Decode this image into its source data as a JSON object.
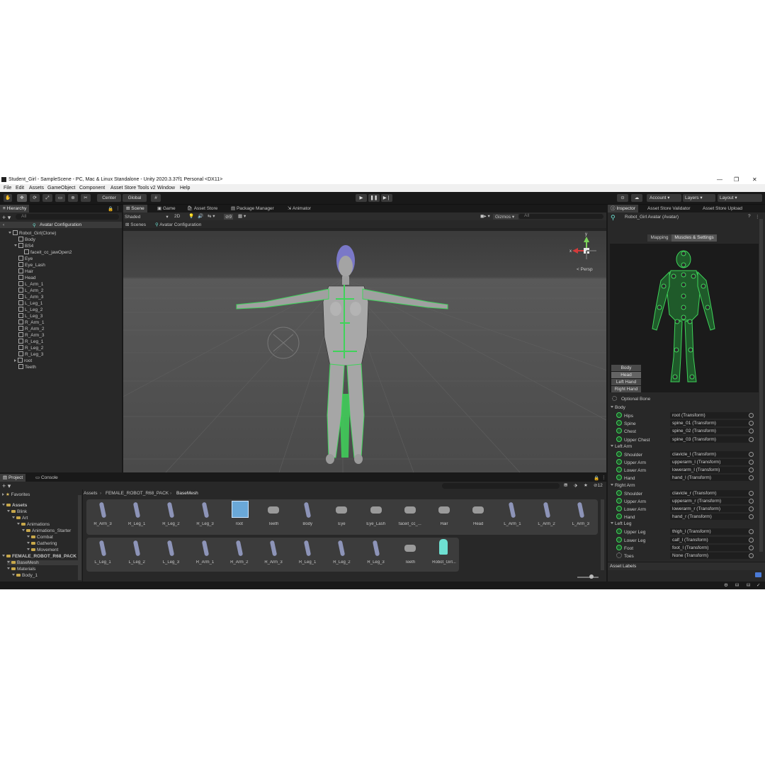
{
  "window": {
    "title": "Student_Girl - SampleScene - PC, Mac & Linux Standalone - Unity 2020.3.37f1 Personal <DX11>",
    "minimize": "—",
    "maximize": "❐",
    "close": "✕"
  },
  "menu": [
    "File",
    "Edit",
    "Assets",
    "GameObject",
    "Component",
    "Asset Store Tools v2",
    "Window",
    "Help"
  ],
  "toolbar": {
    "pivot": "Center",
    "space": "Global",
    "account": "Account",
    "layers": "Layers",
    "layout": "Layout"
  },
  "hierarchy": {
    "tab": "Hierarchy",
    "search_placeholder": "All",
    "root": "Avatar Configuration",
    "items": [
      {
        "label": "Robot_Girl(Clone)",
        "indent": 1,
        "arrow": "down"
      },
      {
        "label": "Body",
        "indent": 2
      },
      {
        "label": "BS4",
        "indent": 2,
        "arrow": "down"
      },
      {
        "label": "faceit_cc_jawOpen2",
        "indent": 3
      },
      {
        "label": "Eye",
        "indent": 2
      },
      {
        "label": "Eye_Lash",
        "indent": 2
      },
      {
        "label": "Hair",
        "indent": 2
      },
      {
        "label": "Head",
        "indent": 2
      },
      {
        "label": "L_Arm_1",
        "indent": 2
      },
      {
        "label": "L_Arm_2",
        "indent": 2
      },
      {
        "label": "L_Arm_3",
        "indent": 2
      },
      {
        "label": "L_Leg_1",
        "indent": 2
      },
      {
        "label": "L_Leg_2",
        "indent": 2
      },
      {
        "label": "L_Leg_3",
        "indent": 2
      },
      {
        "label": "R_Arm_1",
        "indent": 2
      },
      {
        "label": "R_Arm_2",
        "indent": 2
      },
      {
        "label": "R_Arm_3",
        "indent": 2
      },
      {
        "label": "R_Leg_1",
        "indent": 2
      },
      {
        "label": "R_Leg_2",
        "indent": 2
      },
      {
        "label": "R_Leg_3",
        "indent": 2
      },
      {
        "label": "root",
        "indent": 2,
        "arrow": "right"
      },
      {
        "label": "Teeth",
        "indent": 2
      }
    ]
  },
  "scene": {
    "tabs": [
      "Scene",
      "Game",
      "Asset Store",
      "Package Manager",
      "Animator"
    ],
    "shading": "Shaded",
    "mode_2d": "2D",
    "gizmos": "Gizmos",
    "search_placeholder": "All",
    "hidden_count": "9",
    "breadcrumb_scenes": "Scenes",
    "breadcrumb_current": "Avatar Configuration",
    "persp": "Persp",
    "axis_y": "y",
    "axis_x": "x"
  },
  "inspector": {
    "tabs": [
      "Inspector",
      "Asset Store Validator",
      "Asset Store Upload"
    ],
    "object_name": "Robot_Girl Avatar (Avatar)",
    "mode_tabs": [
      "Mapping",
      "Muscles & Settings"
    ],
    "body_parts": [
      "Body",
      "Head",
      "Left Hand",
      "Right Hand"
    ],
    "optional_bone": "Optional Bone",
    "sections": [
      {
        "name": "Body",
        "bones": [
          {
            "label": "Hips",
            "value": "root (Transform)"
          },
          {
            "label": "Spine",
            "value": "spine_01 (Transform)"
          },
          {
            "label": "Chest",
            "value": "spine_02 (Transform)"
          },
          {
            "label": "Upper Chest",
            "value": "spine_03 (Transform)"
          }
        ]
      },
      {
        "name": "Left Arm",
        "bones": [
          {
            "label": "Shoulder",
            "value": "clavicle_l (Transform)"
          },
          {
            "label": "Upper Arm",
            "value": "upperarm_l (Transform)"
          },
          {
            "label": "Lower Arm",
            "value": "lowerarm_l (Transform)"
          },
          {
            "label": "Hand",
            "value": "hand_l (Transform)"
          }
        ]
      },
      {
        "name": "Right Arm",
        "bones": [
          {
            "label": "Shoulder",
            "value": "clavicle_r (Transform)"
          },
          {
            "label": "Upper Arm",
            "value": "upperarm_r (Transform)"
          },
          {
            "label": "Lower Arm",
            "value": "lowerarm_r (Transform)"
          },
          {
            "label": "Hand",
            "value": "hand_r (Transform)"
          }
        ]
      },
      {
        "name": "Left Leg",
        "bones": [
          {
            "label": "Upper Leg",
            "value": "thigh_l (Transform)"
          },
          {
            "label": "Lower Leg",
            "value": "calf_l (Transform)"
          },
          {
            "label": "Foot",
            "value": "foot_l (Transform)"
          },
          {
            "label": "Toes",
            "value": "None (Transform)"
          }
        ]
      }
    ],
    "asset_labels": "Asset Labels"
  },
  "project": {
    "tabs": [
      "Project",
      "Console"
    ],
    "favorites": "Favorites",
    "tree": [
      {
        "label": "Assets",
        "indent": 0
      },
      {
        "label": "Blink",
        "indent": 1
      },
      {
        "label": "Art",
        "indent": 2
      },
      {
        "label": "Animations",
        "indent": 3
      },
      {
        "label": "Animations_Starter",
        "indent": 4
      },
      {
        "label": "Combat",
        "indent": 5
      },
      {
        "label": "Gathering",
        "indent": 5
      },
      {
        "label": "Movement",
        "indent": 5
      },
      {
        "label": "FEMALE_ROBOT_R68_PACK",
        "indent": 0
      },
      {
        "label": "BaseMesh",
        "indent": 1
      },
      {
        "label": "Materials",
        "indent": 1
      },
      {
        "label": "Body_1",
        "indent": 2
      }
    ],
    "breadcrumb": [
      "Assets",
      "FEMALE_ROBOT_R68_PACK",
      "BaseMesh"
    ],
    "hidden_count": "12",
    "row1": [
      "R_Arm_3",
      "R_Leg_1",
      "R_Leg_2",
      "R_Leg_3",
      "root",
      "Teeth",
      "Body",
      "Eye",
      "Eye_Lash",
      "faceit_cc_...",
      "Hair",
      "Head",
      "L_Arm_1",
      "L_Arm_2",
      "L_Arm_3"
    ],
    "row2": [
      "L_Leg_1",
      "L_Leg_2",
      "L_Leg_3",
      "R_Arm_1",
      "R_Arm_2",
      "R_Arm_3",
      "R_Leg_1",
      "R_Leg_2",
      "R_Leg_3",
      "Teeth",
      "Robot_Girl..."
    ]
  },
  "colors": {
    "accent_green": "#3fd35a",
    "panel": "#282828",
    "bar": "#191919",
    "prefab_cyan": "#6ee0d2"
  }
}
